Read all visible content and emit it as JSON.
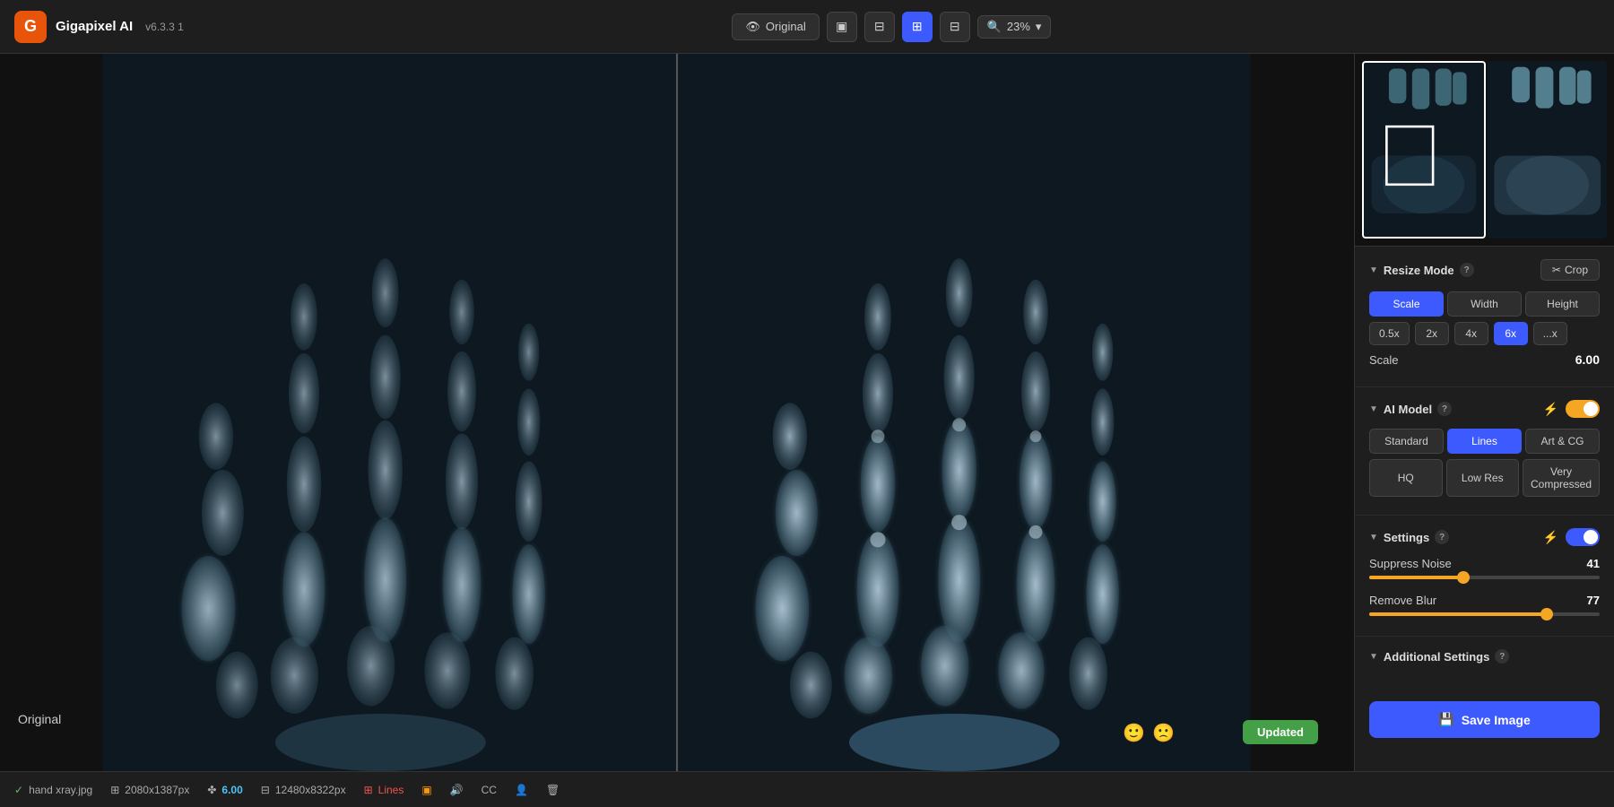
{
  "app": {
    "name": "Gigapixel AI",
    "version": "v6.3.3 1",
    "logo_letter": "G"
  },
  "topbar": {
    "original_btn": "Original",
    "view_modes": [
      "single",
      "split-v",
      "split-h",
      "grid"
    ],
    "zoom_level": "23%",
    "zoom_icon": "🔍"
  },
  "canvas": {
    "left_label": "Original",
    "mode_label": "Lines",
    "updated_label": "Updated"
  },
  "statusbar": {
    "filename": "hand xray.jpg",
    "input_size": "2080x1387px",
    "scale": "6.00",
    "output_size": "12480x8322px",
    "model": "Lines",
    "icons": [
      "image-icon",
      "scale-icon",
      "output-icon",
      "model-icon",
      "color-icon",
      "audio-icon",
      "cc-icon",
      "person-icon",
      "trash-icon"
    ]
  },
  "panel": {
    "thumbnail": {
      "images": [
        "thumb1",
        "thumb2"
      ]
    },
    "resize_mode": {
      "title": "Resize Mode",
      "crop_label": "Crop",
      "buttons": {
        "scale": "Scale",
        "width": "Width",
        "height": "Height"
      },
      "scale_presets": [
        "0.5x",
        "2x",
        "4x",
        "6x",
        "...x"
      ],
      "active_preset": "6x",
      "scale_label": "Scale",
      "scale_value": "6.00"
    },
    "ai_model": {
      "title": "AI Model",
      "tabs_row1": [
        "Standard",
        "Lines",
        "Art & CG"
      ],
      "active_row1": "Lines",
      "tabs_row2": [
        "HQ",
        "Low Res",
        "Very Compressed"
      ],
      "active_row2": null
    },
    "settings": {
      "title": "Settings",
      "toggle_on": true,
      "suppress_noise": {
        "label": "Suppress Noise",
        "value": 41,
        "percent": 41
      },
      "remove_blur": {
        "label": "Remove Blur",
        "value": 77,
        "percent": 77
      }
    },
    "additional_settings": {
      "title": "Additional Settings"
    },
    "save_btn": "Save Image"
  }
}
